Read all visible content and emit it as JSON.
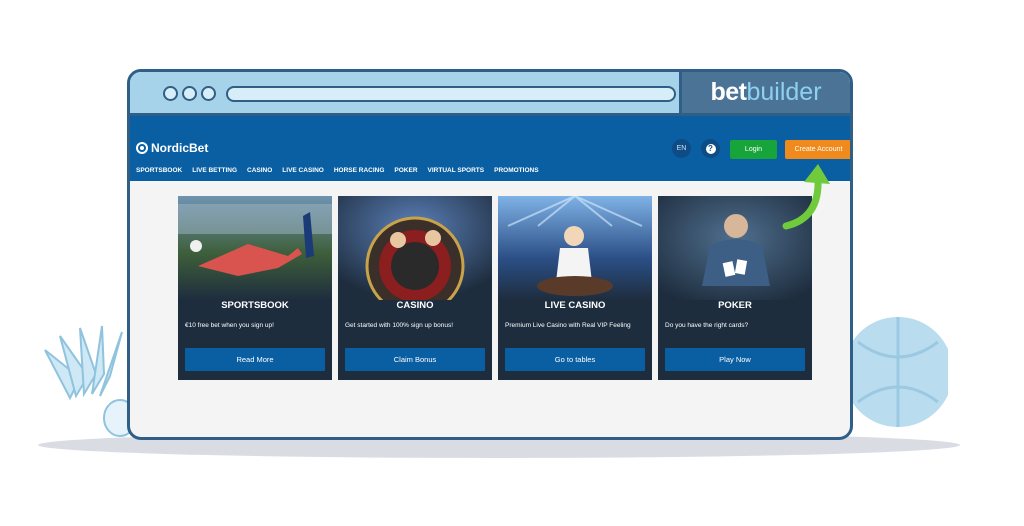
{
  "brand": {
    "bet": "bet",
    "builder": "builder"
  },
  "site": {
    "logo": "NordicBet",
    "nav": [
      "SPORTSBOOK",
      "LIVE BETTING",
      "CASINO",
      "LIVE CASINO",
      "HORSE RACING",
      "POKER",
      "VIRTUAL SPORTS",
      "PROMOTIONS"
    ],
    "language": "EN",
    "help_icon": "?",
    "login_label": "Login",
    "create_account_label": "Create Account"
  },
  "cards": [
    {
      "title": "SPORTSBOOK",
      "description": "€10 free bet when you sign up!",
      "button": "Read More"
    },
    {
      "title": "CASINO",
      "description": "Get started with 100% sign up bonus!",
      "button": "Claim Bonus"
    },
    {
      "title": "LIVE CASINO",
      "description": "Premium Live Casino with Real VIP Feeling",
      "button": "Go to tables"
    },
    {
      "title": "POKER",
      "description": "Do you have the right cards?",
      "button": "Play Now"
    }
  ],
  "colors": {
    "header": "#0a5fa3",
    "login": "#17a43a",
    "create_account": "#f08a1c",
    "arrow": "#6fcb3c"
  }
}
